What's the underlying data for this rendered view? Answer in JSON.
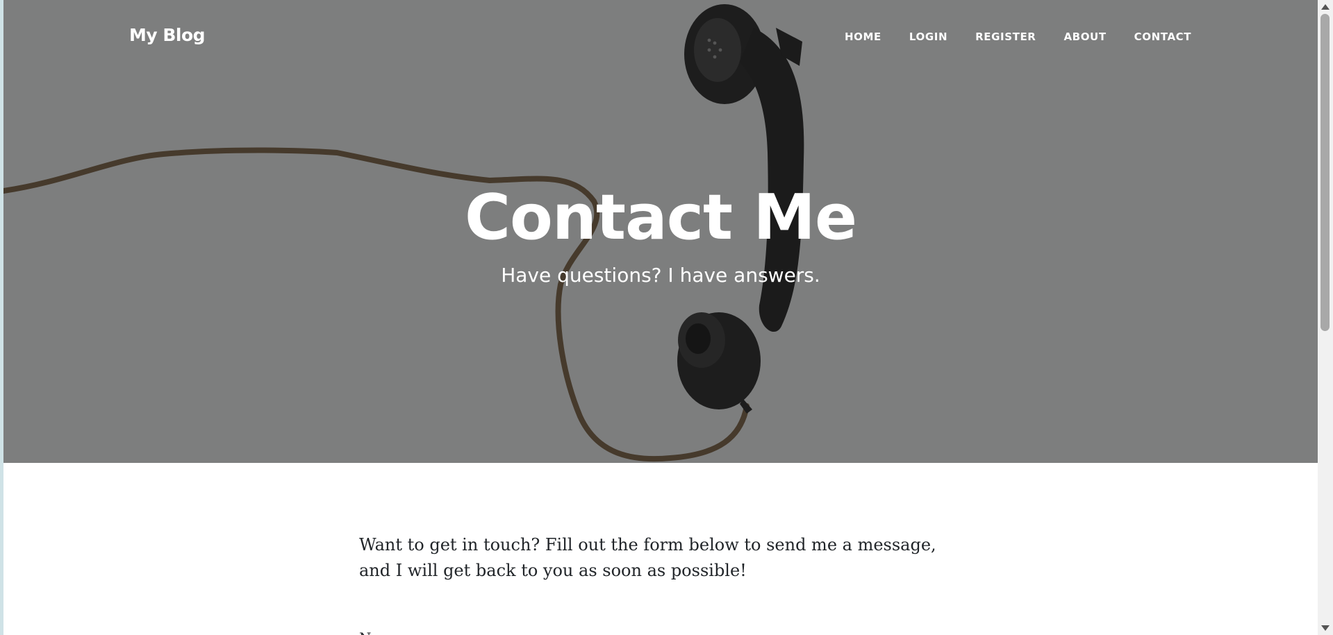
{
  "brand": "My Blog",
  "nav": {
    "items": [
      {
        "label": "HOME"
      },
      {
        "label": "LOGIN"
      },
      {
        "label": "REGISTER"
      },
      {
        "label": "ABOUT"
      },
      {
        "label": "CONTACT"
      }
    ]
  },
  "hero": {
    "title": "Contact Me",
    "subtitle": "Have questions? I have answers.",
    "background_image": "telephone-handset-icon",
    "overlay_color": "#7d7e7e"
  },
  "content": {
    "intro": "Want to get in touch? Fill out the form below to send me a message, and I will get back to you as soon as possible!",
    "first_field_label": "Name"
  },
  "colors": {
    "text": "#212529",
    "hero_text": "#ffffff",
    "hero_background": "#7d7e7e"
  }
}
